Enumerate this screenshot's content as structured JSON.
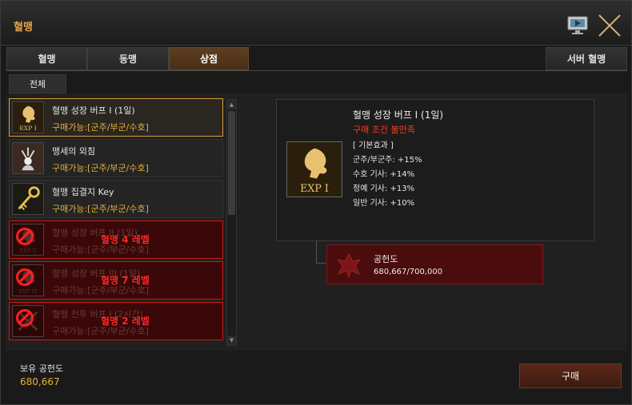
{
  "window": {
    "title": "혈맹"
  },
  "tabs": [
    {
      "label": "혈맹"
    },
    {
      "label": "동맹"
    },
    {
      "label": "상점"
    },
    {
      "label": "서버 혈맹"
    }
  ],
  "subtab": {
    "label": "전체"
  },
  "list": [
    {
      "name": "혈맹 성장 버프 I (1일)",
      "cond": "구매가능:[군주/부군/수호]",
      "icon": "exp-one-lion-icon"
    },
    {
      "name": "맹세의 외침",
      "cond": "구매가능:[군주/부군/수호]",
      "icon": "oath-shout-icon"
    },
    {
      "name": "혈맹 집결지 Key",
      "cond": "구매가능:[군주/부군/수호]",
      "icon": "golden-key-icon"
    },
    {
      "name": "혈맹 성장 버프 II (1일)",
      "cond": "구매가능:[군주/부군/수호]",
      "lock": "혈맹 4 레벨",
      "icon": "exp-two-lion-icon"
    },
    {
      "name": "혈맹 성장 버프 III (1일)",
      "cond": "구매가능:[군주/부군/수호]",
      "lock": "혈맹 7 레벨",
      "icon": "exp-three-lion-icon"
    },
    {
      "name": "혈맹 전투 버프 I (2시간)",
      "cond": "구매가능:[군주/부군/수호]",
      "lock": "혈맹 2 레벨",
      "icon": "battle-buff-icon"
    }
  ],
  "detail": {
    "name": "혈맹 성장 버프 I (1일)",
    "condition": "구매 조건 불만족",
    "effect_header": "[ 기본효과 ]",
    "effects": [
      "군주/부군주: +15%",
      "수호 기사: +14%",
      "정예 기사: +13%",
      "일반 기사: +10%"
    ],
    "icon": "exp-one-lion-icon"
  },
  "cost": {
    "label": "공헌도",
    "value": "680,667/700,000",
    "icon": "blood-pledge-emblem-icon"
  },
  "footer": {
    "owned_label": "보유 공헌도",
    "owned_value": "680,667",
    "buy_label": "구매"
  },
  "colors": {
    "accent_gold": "#e7b03a",
    "locked_red": "#ff2a2a",
    "active_tab": "#5e3e22"
  }
}
